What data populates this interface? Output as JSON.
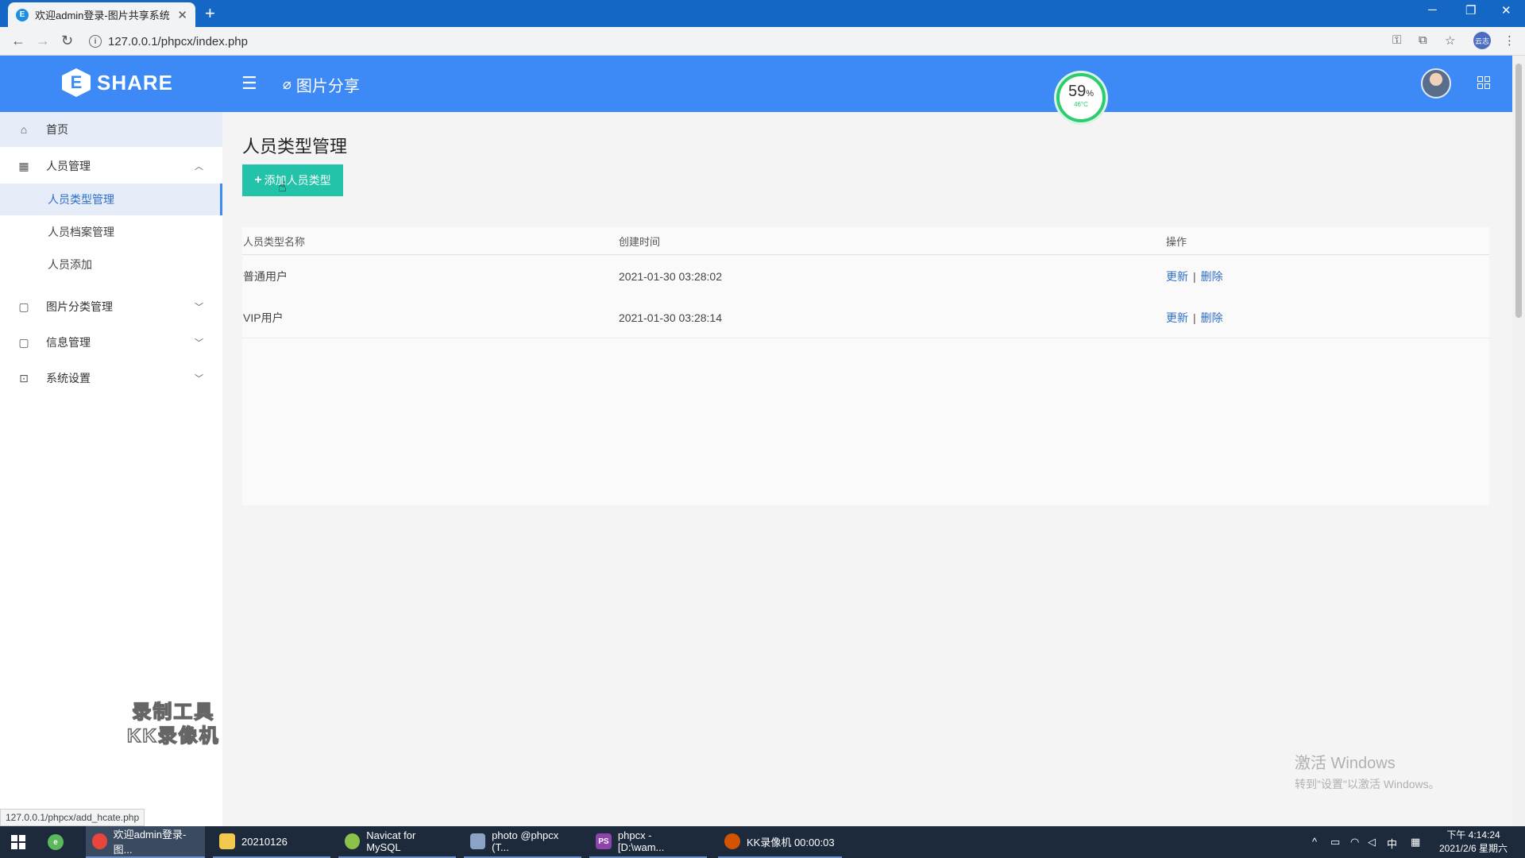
{
  "browser": {
    "tab_title": "欢迎admin登录-图片共享系统",
    "tab_favicon": "E",
    "url": "127.0.0.1/phpcx/index.php",
    "profile_label": "云志"
  },
  "header": {
    "brand": "SHARE",
    "brand_mark": "E",
    "link_label": "图片分享",
    "perf_percent": "59",
    "perf_unit": "%",
    "perf_temp": "46°C"
  },
  "sidebar": {
    "home": "首页",
    "people": "人员管理",
    "sub": [
      "人员类型管理",
      "人员档案管理",
      "人员添加"
    ],
    "pic_category": "图片分类管理",
    "info": "信息管理",
    "settings": "系统设置"
  },
  "main": {
    "title": "人员类型管理",
    "add_button": "添加人员类型",
    "columns": [
      "人员类型名称",
      "创建时间",
      "操作"
    ],
    "rows": [
      {
        "name": "普通用户",
        "created": "2021-01-30 03:28:02",
        "update": "更新",
        "delete": "删除"
      },
      {
        "name": "VIP用户",
        "created": "2021-01-30 03:28:14",
        "update": "更新",
        "delete": "删除"
      }
    ],
    "separator": "|"
  },
  "overlay": {
    "kk_line1": "录制工具",
    "kk_line2": "KK录像机",
    "windows_line1": "激活 Windows",
    "windows_line2": "转到\"设置\"以激活 Windows。",
    "status_url": "127.0.0.1/phpcx/add_hcate.php"
  },
  "taskbar": {
    "apps": [
      "欢迎admin登录-图...",
      "20210126",
      "Navicat for MySQL",
      "photo @phpcx (T...",
      "phpcx - [D:\\wam...",
      "KK录像机 00:00:03"
    ],
    "ime": "中",
    "time": "下午 4:14:24",
    "date": "2021/2/6 星期六"
  },
  "colors": {
    "header_blue": "#3d8af7",
    "add_button_green": "#22c3a8",
    "link_blue": "#2f6dc8"
  }
}
